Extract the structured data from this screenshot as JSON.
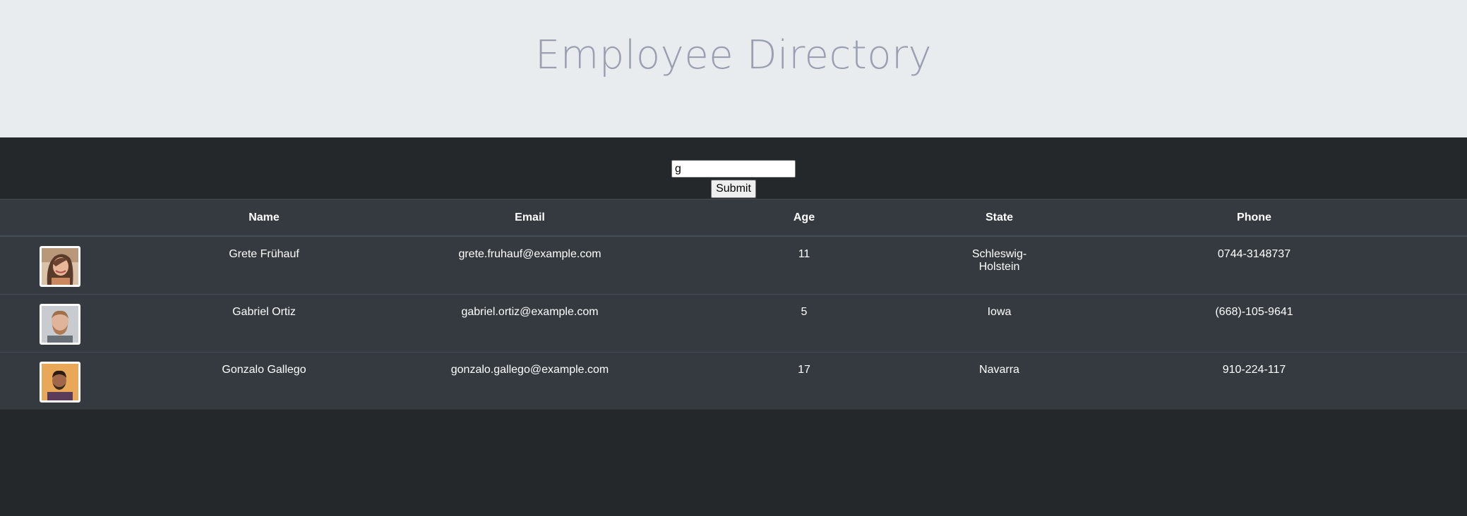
{
  "header": {
    "title": "Employee Directory"
  },
  "search": {
    "value": "g",
    "submit_label": "Submit"
  },
  "table": {
    "columns": [
      "",
      "Name",
      "Email",
      "Age",
      "State",
      "Phone"
    ],
    "rows": [
      {
        "avatar": "woman-portrait-photo",
        "name": "Grete Frühauf",
        "email": "grete.fruhauf@example.com",
        "age": "11",
        "state": "Schleswig-Holstein",
        "phone": "0744-3148737"
      },
      {
        "avatar": "bearded-man-portrait-photo",
        "name": "Gabriel Ortiz",
        "email": "gabriel.ortiz@example.com",
        "age": "5",
        "state": "Iowa",
        "phone": "(668)-105-9641"
      },
      {
        "avatar": "man-portrait-photo",
        "name": "Gonzalo Gallego",
        "email": "gonzalo.gallego@example.com",
        "age": "17",
        "state": "Navarra",
        "phone": "910-224-117"
      }
    ]
  },
  "colors": {
    "header_bg": "#e9ecef",
    "title": "#9aa0b0",
    "page_bg": "#24282b",
    "table_bg": "#343a40",
    "table_border": "#454d55"
  }
}
